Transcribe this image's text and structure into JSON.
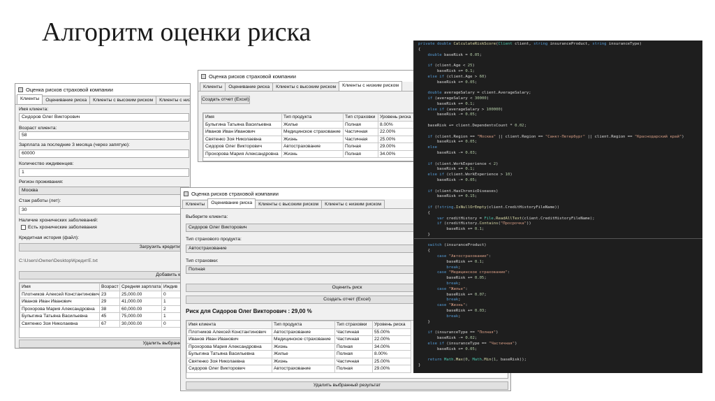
{
  "slide": {
    "title": "Алгоритм оценки риска"
  },
  "win1": {
    "title": "Оценка рисков страховой компании",
    "tabs": [
      "Клиенты",
      "Оценивание риска",
      "Клиенты с высоким риском",
      "Клиенты с низким риском"
    ],
    "name_label": "Имя клиента:",
    "name_value": "Сидоров Олег Викторович",
    "age_label": "Возраст клиента:",
    "age_value": "58",
    "salary_label": "Зарплата за последние 3 месяца (через запятую):",
    "salary_value": "60000",
    "deps_label": "Количество иждивенцев:",
    "deps_value": "1",
    "region_label": "Регион проживания:",
    "region_value": "Москва",
    "exp_label": "Стаж работы (лет):",
    "exp_value": "30",
    "chronic_label": "Наличие хронических заболеваний:",
    "chronic_check": "Есть хронические заболевания",
    "history_label": "Кредитная история (файл):",
    "load_button": "Загрузить кредитную",
    "file_path": "C:\\Users\\Owner\\Desktop\\КредитЕ.txt",
    "add_button": "Добавить кли",
    "columns": [
      "Имя",
      "Возраст",
      "Средняя зарплата",
      "Иждив"
    ],
    "rows": [
      [
        "Плотников Алексей Константинович",
        "23",
        "25,000.00",
        "0"
      ],
      [
        "Иванов Иван Иванович",
        "29",
        "41,000.00",
        "1"
      ],
      [
        "Прохорова Мария Александровна",
        "38",
        "60,000.00",
        "2"
      ],
      [
        "Булыгина Татьяна Васильевна",
        "45",
        "75,000.00",
        "1"
      ],
      [
        "Святенко Зоя Николаевна",
        "67",
        "30,000.00",
        "0"
      ]
    ],
    "delete_button": "Удалить выбранног"
  },
  "win2": {
    "title": "Оценка рисков страховой компании",
    "tabs": [
      "Клиенты",
      "Оценивание риска",
      "Клиенты с высоким риском",
      "Клиенты с низким риском"
    ],
    "report_button": "Создать отчет (Excel)",
    "columns": [
      "Имя",
      "Тип продукта",
      "Тип страховки",
      "Уровень риска"
    ],
    "rows": [
      [
        "Булыгина Татьяна Васильевна",
        "Жилье",
        "Полная",
        "8.00%"
      ],
      [
        "Иванов Иван Иванович",
        "Медицинское страхование",
        "Частичная",
        "22.00%"
      ],
      [
        "Святенко Зоя Николаевна",
        "Жизнь",
        "Частичная",
        "25.00%"
      ],
      [
        "Сидоров Олег Викторович",
        "Автострахование",
        "Полная",
        "29.00%"
      ],
      [
        "Прохорова Мария Александровна",
        "Жизнь",
        "Полная",
        "34.00%"
      ]
    ]
  },
  "win3": {
    "title": "Оценка рисков страховой компании",
    "tabs": [
      "Клиенты",
      "Оценивание риска",
      "Клиенты с высоким риском",
      "Клиенты с низким риском"
    ],
    "client_label": "Выберите клиента:",
    "client_value": "Сидоров Олег Викторович",
    "product_label": "Тип страхового продукта:",
    "product_value": "Автострахование",
    "insurance_label": "Тип страховки:",
    "insurance_value": "Полная",
    "assess_button": "Оценить риск",
    "report_button": "Создать отчет (Excel)",
    "risk_text": "Риск для Сидоров Олег Викторович : 29,00 %",
    "columns": [
      "Имя клиента",
      "Тип продукта",
      "Тип страховки",
      "Уровень риска"
    ],
    "rows": [
      [
        "Плотников Алексей Константинович",
        "Автострахование",
        "Частичная",
        "55.00%"
      ],
      [
        "Иванов Иван Иванович",
        "Медицинское страхование",
        "Частичная",
        "22.00%"
      ],
      [
        "Прохорова Мария Александровна",
        "Жизнь",
        "Полная",
        "34.00%"
      ],
      [
        "Булыгина Татьяна Васильевна",
        "Жилье",
        "Полная",
        "8.00%"
      ],
      [
        "Святенко Зоя Николаевна",
        "Жизнь",
        "Частичная",
        "25.00%"
      ],
      [
        "Сидоров Олег Викторович",
        "Автострахование",
        "Полная",
        "29.00%"
      ]
    ],
    "delete_button": "Удалить выбранный результат"
  },
  "code": {
    "lines": [
      [
        [
          "kw",
          "private double "
        ],
        [
          "fn",
          "CalculateRiskScore"
        ],
        [
          "tx",
          "("
        ],
        [
          "ty",
          "Client"
        ],
        [
          "tx",
          " client, "
        ],
        [
          "kw",
          "string"
        ],
        [
          "tx",
          " insuranceProduct, "
        ],
        [
          "kw",
          "string"
        ],
        [
          "tx",
          " insuranceType)"
        ]
      ],
      [
        [
          "tx",
          "{"
        ]
      ],
      [
        [
          "kw",
          "    double"
        ],
        [
          "tx",
          " baseRisk = "
        ],
        [
          "nm",
          "0.05"
        ],
        [
          "tx",
          ";"
        ]
      ],
      [
        [
          "tx",
          ""
        ]
      ],
      [
        [
          "kw",
          "    if"
        ],
        [
          "tx",
          " (client.Age < "
        ],
        [
          "nm",
          "25"
        ],
        [
          "tx",
          ")"
        ]
      ],
      [
        [
          "tx",
          "        baseRisk += "
        ],
        [
          "nm",
          "0.1"
        ],
        [
          "tx",
          ";"
        ]
      ],
      [
        [
          "kw",
          "    else if"
        ],
        [
          "tx",
          " (client.Age > "
        ],
        [
          "nm",
          "60"
        ],
        [
          "tx",
          ")"
        ]
      ],
      [
        [
          "tx",
          "        baseRisk += "
        ],
        [
          "nm",
          "0.05"
        ],
        [
          "tx",
          ";"
        ]
      ],
      [
        [
          "tx",
          ""
        ]
      ],
      [
        [
          "kw",
          "    double"
        ],
        [
          "tx",
          " averageSalary = client.AverageSalary;"
        ]
      ],
      [
        [
          "kw",
          "    if"
        ],
        [
          "tx",
          " (averageSalary < "
        ],
        [
          "nm",
          "30000"
        ],
        [
          "tx",
          ")"
        ]
      ],
      [
        [
          "tx",
          "        baseRisk += "
        ],
        [
          "nm",
          "0.1"
        ],
        [
          "tx",
          ";"
        ]
      ],
      [
        [
          "kw",
          "    else if"
        ],
        [
          "tx",
          " (averageSalary > "
        ],
        [
          "nm",
          "100000"
        ],
        [
          "tx",
          ")"
        ]
      ],
      [
        [
          "tx",
          "        baseRisk -= "
        ],
        [
          "nm",
          "0.05"
        ],
        [
          "tx",
          ";"
        ]
      ],
      [
        [
          "tx",
          ""
        ]
      ],
      [
        [
          "tx",
          "    baseRisk += client.DependentsCount * "
        ],
        [
          "nm",
          "0.02"
        ],
        [
          "tx",
          ";"
        ]
      ],
      [
        [
          "tx",
          ""
        ]
      ],
      [
        [
          "kw",
          "    if"
        ],
        [
          "tx",
          " (client.Region == "
        ],
        [
          "st",
          "\"Москва\""
        ],
        [
          "tx",
          " || client.Region == "
        ],
        [
          "st",
          "\"Санкт-Петербург\""
        ],
        [
          "tx",
          " || client.Region == "
        ],
        [
          "st",
          "\"Краснодарский край\""
        ],
        [
          "tx",
          ")"
        ]
      ],
      [
        [
          "tx",
          "        baseRisk += "
        ],
        [
          "nm",
          "0.05"
        ],
        [
          "tx",
          ";"
        ]
      ],
      [
        [
          "kw",
          "    else"
        ]
      ],
      [
        [
          "tx",
          "        baseRisk -= "
        ],
        [
          "nm",
          "0.03"
        ],
        [
          "tx",
          ";"
        ]
      ],
      [
        [
          "tx",
          ""
        ]
      ],
      [
        [
          "kw",
          "    if"
        ],
        [
          "tx",
          " (client.WorkExperience < "
        ],
        [
          "nm",
          "2"
        ],
        [
          "tx",
          ")"
        ]
      ],
      [
        [
          "tx",
          "        baseRisk += "
        ],
        [
          "nm",
          "0.1"
        ],
        [
          "tx",
          ";"
        ]
      ],
      [
        [
          "kw",
          "    else if"
        ],
        [
          "tx",
          " (client.WorkExperience > "
        ],
        [
          "nm",
          "10"
        ],
        [
          "tx",
          ")"
        ]
      ],
      [
        [
          "tx",
          "        baseRisk -= "
        ],
        [
          "nm",
          "0.05"
        ],
        [
          "tx",
          ";"
        ]
      ],
      [
        [
          "tx",
          ""
        ]
      ],
      [
        [
          "kw",
          "    if"
        ],
        [
          "tx",
          " (client.HasChronicDiseases)"
        ]
      ],
      [
        [
          "tx",
          "        baseRisk += "
        ],
        [
          "nm",
          "0.15"
        ],
        [
          "tx",
          ";"
        ]
      ],
      [
        [
          "tx",
          ""
        ]
      ],
      [
        [
          "kw",
          "    if"
        ],
        [
          "tx",
          " (!"
        ],
        [
          "kw",
          "string"
        ],
        [
          "tx",
          "."
        ],
        [
          "fn",
          "IsNullOrEmpty"
        ],
        [
          "tx",
          "(client.CreditHistoryFileName))"
        ]
      ],
      [
        [
          "tx",
          "    {"
        ]
      ],
      [
        [
          "kw",
          "        var"
        ],
        [
          "tx",
          " creditHistory = "
        ],
        [
          "ty",
          "File"
        ],
        [
          "tx",
          "."
        ],
        [
          "fn",
          "ReadAllText"
        ],
        [
          "tx",
          "(client.CreditHistoryFileName);"
        ]
      ],
      [
        [
          "kw",
          "        if"
        ],
        [
          "tx",
          " (creditHistory."
        ],
        [
          "fn",
          "Contains"
        ],
        [
          "tx",
          "("
        ],
        [
          "st",
          "\"Просрочка\""
        ],
        [
          "tx",
          "))"
        ]
      ],
      [
        [
          "tx",
          "            baseRisk += "
        ],
        [
          "nm",
          "0.1"
        ],
        [
          "tx",
          ";"
        ]
      ],
      [
        [
          "tx",
          "    }"
        ]
      ],
      [
        [
          "tx",
          ""
        ]
      ],
      [
        [
          "kw",
          "    switch"
        ],
        [
          "tx",
          " (insuranceProduct)"
        ]
      ],
      [
        [
          "tx",
          "    {"
        ]
      ],
      [
        [
          "kw",
          "        case "
        ],
        [
          "st",
          "\"Автострахование\""
        ],
        [
          "tx",
          ":"
        ]
      ],
      [
        [
          "tx",
          "            baseRisk += "
        ],
        [
          "nm",
          "0.1"
        ],
        [
          "tx",
          ";"
        ]
      ],
      [
        [
          "kw",
          "            break"
        ],
        [
          "tx",
          ";"
        ]
      ],
      [
        [
          "kw",
          "        case "
        ],
        [
          "st",
          "\"Медицинское страхование\""
        ],
        [
          "tx",
          ":"
        ]
      ],
      [
        [
          "tx",
          "            baseRisk += "
        ],
        [
          "nm",
          "0.05"
        ],
        [
          "tx",
          ";"
        ]
      ],
      [
        [
          "kw",
          "            break"
        ],
        [
          "tx",
          ";"
        ]
      ],
      [
        [
          "kw",
          "        case "
        ],
        [
          "st",
          "\"Жилье\""
        ],
        [
          "tx",
          ":"
        ]
      ],
      [
        [
          "tx",
          "            baseRisk += "
        ],
        [
          "nm",
          "0.07"
        ],
        [
          "tx",
          ";"
        ]
      ],
      [
        [
          "kw",
          "            break"
        ],
        [
          "tx",
          ";"
        ]
      ],
      [
        [
          "kw",
          "        case "
        ],
        [
          "st",
          "\"Жизнь\""
        ],
        [
          "tx",
          ":"
        ]
      ],
      [
        [
          "tx",
          "            baseRisk += "
        ],
        [
          "nm",
          "0.03"
        ],
        [
          "tx",
          ";"
        ]
      ],
      [
        [
          "kw",
          "            break"
        ],
        [
          "tx",
          ";"
        ]
      ],
      [
        [
          "tx",
          "    }"
        ]
      ],
      [
        [
          "tx",
          ""
        ]
      ],
      [
        [
          "kw",
          "    if"
        ],
        [
          "tx",
          " (insuranceType == "
        ],
        [
          "st",
          "\"Полная\""
        ],
        [
          "tx",
          ")"
        ]
      ],
      [
        [
          "tx",
          "        baseRisk -= "
        ],
        [
          "nm",
          "0.02"
        ],
        [
          "tx",
          ";"
        ]
      ],
      [
        [
          "kw",
          "    else if"
        ],
        [
          "tx",
          " (insuranceType == "
        ],
        [
          "st",
          "\"Частичная\""
        ],
        [
          "tx",
          ")"
        ]
      ],
      [
        [
          "tx",
          "        baseRisk += "
        ],
        [
          "nm",
          "0.05"
        ],
        [
          "tx",
          ";"
        ]
      ],
      [
        [
          "tx",
          ""
        ]
      ],
      [
        [
          "kw",
          "    return"
        ],
        [
          "ty",
          " Math"
        ],
        [
          "tx",
          "."
        ],
        [
          "fn",
          "Max"
        ],
        [
          "tx",
          "("
        ],
        [
          "nm",
          "0"
        ],
        [
          "tx",
          ", "
        ],
        [
          "ty",
          "Math"
        ],
        [
          "tx",
          "."
        ],
        [
          "fn",
          "Min"
        ],
        [
          "tx",
          "("
        ],
        [
          "nm",
          "1"
        ],
        [
          "tx",
          ", baseRisk));"
        ]
      ],
      [
        [
          "tx",
          "}"
        ]
      ]
    ],
    "colors": {
      "kw": "#569cd6",
      "fn": "#dcdcaa",
      "ty": "#4ec9b0",
      "st": "#d69d85",
      "nm": "#b5cea8",
      "tx": "#dcdcdc"
    }
  }
}
